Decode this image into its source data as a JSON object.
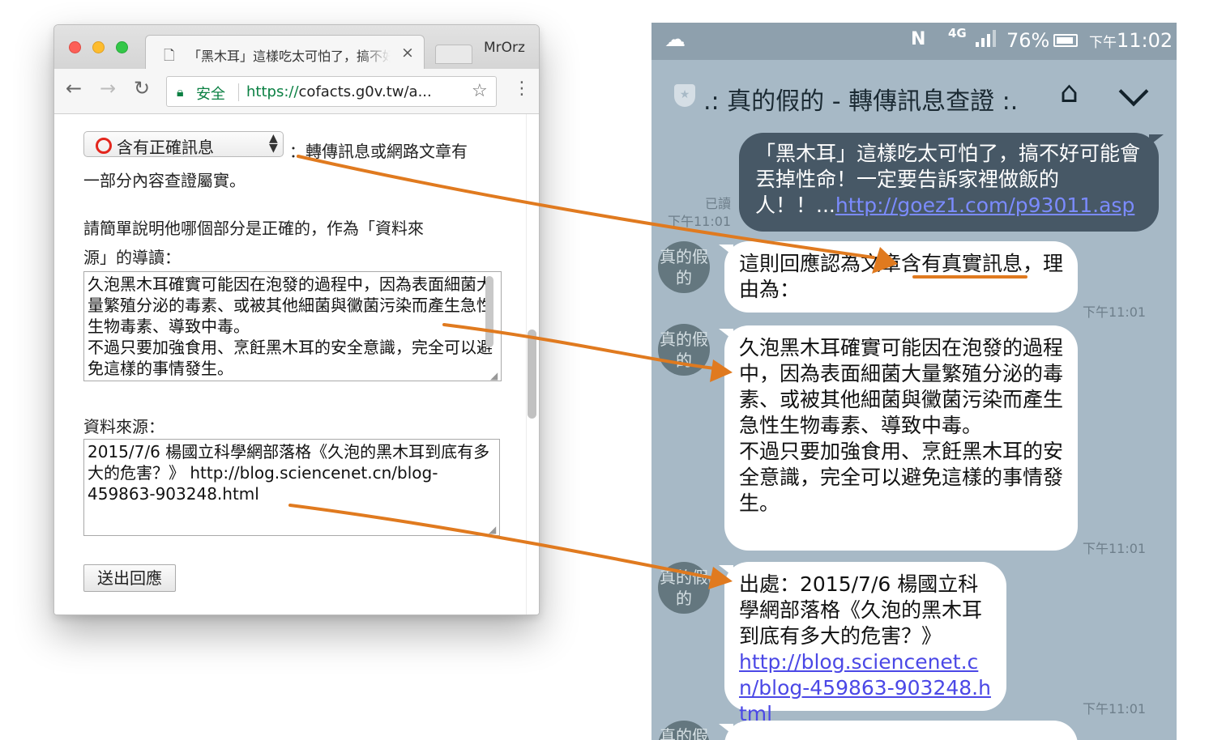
{
  "browser": {
    "tab_title": "「黑木耳」這樣吃太可怕了，搞不好可能會丟掉性命",
    "profile_name": "MrOrz",
    "secure_label": "安全",
    "url_scheme": "https://",
    "url_rest": "cofacts.g0v.tw/a...",
    "icons": [
      "doc-icon",
      "close-icon",
      "back-icon",
      "forward-icon",
      "reload-icon",
      "lock-icon",
      "star-icon",
      "menu-icon"
    ]
  },
  "form": {
    "category_selected": "含有正確訊息",
    "category_desc_line1": "：轉傳訊息或網路文章有",
    "category_desc_line2": "一部分內容查證屬實。",
    "prompt_line1": "請簡單說明他哪個部分是正確的，作為「資料來",
    "prompt_line2": "源」的導讀：",
    "reason_text": "久泡黑木耳確實可能因在泡發的過程中，因為表面細菌大量繁殖分泌的毒素、或被其他細菌與黴菌污染而產生急性生物毒素、導致中毒。\n不過只要加強食用、烹飪黑木耳的安全意識，完全可以避免這樣的事情發生。",
    "source_label": "資料來源：",
    "source_text": "2015/7/6 楊國立科學網部落格《久泡的黑木耳到底有多大的危害？》 http://blog.sciencenet.cn/blog-459863-903248.html",
    "submit_label": "送出回應"
  },
  "phone": {
    "status": {
      "network": "4G",
      "battery": "76%",
      "time_prefix": "下午",
      "time": "11:02",
      "icons": [
        "cloud-icon",
        "nfc-icon",
        "signal-icon",
        "battery-icon"
      ]
    },
    "chat_title": ".: 真的假的 - 轉傳訊息查證 :.",
    "outgoing": {
      "text": "「黑木耳」這樣吃太可怕了，搞不好可能會丟掉性命！一定要告訴家裡做飯的人！！...",
      "link": "http://goez1.com/p93011.asp",
      "read_label": "已讀",
      "time": "下午11:01"
    },
    "avatar_text": "真的假的",
    "messages": [
      {
        "text": "這則回應認為文章含有真實訊息，理由為：",
        "time": "下午11:01"
      },
      {
        "text": "久泡黑木耳確實可能因在泡發的過程中，因為表面細菌大量繁殖分泌的毒素、或被其他細菌與黴菌污染而產生急性生物毒素、導致中毒。\n不過只要加強食用、烹飪黑木耳的安全意識，完全可以避免這樣的事情發生。",
        "time": "下午11:01"
      },
      {
        "text": "出處：2015/7/6 楊國立科學網部落格《久泡的黑木耳到底有多大的危害？》",
        "link": "http://blog.sciencenet.cn/blog-459863-903248.html",
        "time": "下午11:01"
      }
    ]
  },
  "colors": {
    "arrow": "#e07a1f",
    "line_bg": "#a7b9c6",
    "outgoing_bubble": "#475866",
    "secure_green": "#0b8043",
    "option_ring": "#e3261d"
  }
}
